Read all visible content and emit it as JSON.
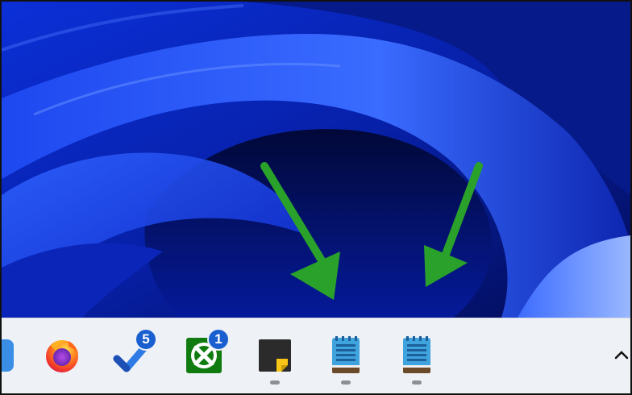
{
  "wallpaper": {
    "colors": {
      "deep": "#020a4a",
      "mid": "#0a25c8",
      "bright": "#2f62ff",
      "light": "#7fa6ff"
    }
  },
  "taskbar": {
    "background": "#eef1f6",
    "apps": [
      {
        "name": "partial-app",
        "icon": "partial-blue-app-icon"
      },
      {
        "name": "firefox",
        "icon": "firefox-icon"
      },
      {
        "name": "todo",
        "icon": "checkmark-icon",
        "badge": "5"
      },
      {
        "name": "xbox",
        "icon": "xbox-icon",
        "badge": "1"
      },
      {
        "name": "sticky-notes",
        "icon": "sticky-notes-icon",
        "running": true
      },
      {
        "name": "notepad-1",
        "icon": "notepad-icon",
        "running": true
      },
      {
        "name": "notepad-2",
        "icon": "notepad-icon",
        "running": true
      }
    ],
    "overflow_icon": "chevron-up-icon"
  },
  "annotations": {
    "arrow_color": "#2aa12a",
    "arrows": [
      "green-arrow-icon",
      "green-arrow-icon"
    ]
  }
}
